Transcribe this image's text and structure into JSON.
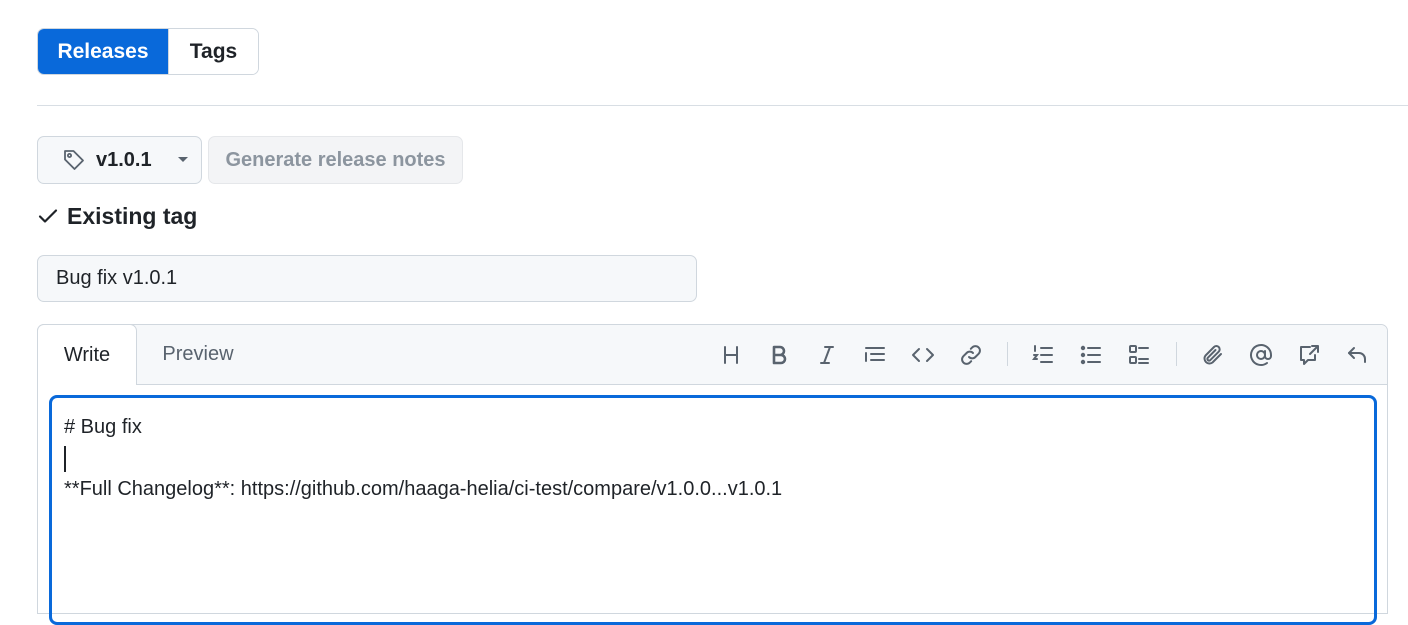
{
  "tabs": {
    "releases": "Releases",
    "tags": "Tags"
  },
  "tag_selector": {
    "value": "v1.0.1",
    "icon": "tag-icon"
  },
  "generate_notes_label": "Generate release notes",
  "tag_status": "Existing tag",
  "release_title": {
    "value": "Bug fix v1.0.1"
  },
  "editor": {
    "tab_write": "Write",
    "tab_preview": "Preview",
    "toolbar": [
      "heading",
      "bold",
      "italic",
      "quote",
      "code",
      "link",
      "ordered-list",
      "unordered-list",
      "task-list",
      "attach",
      "mention",
      "reference",
      "undo"
    ],
    "lines": [
      "# Bug fix",
      "",
      "**Full Changelog**: https://github.com/haaga-helia/ci-test/compare/v1.0.0...v1.0.1"
    ]
  },
  "colors": {
    "accent": "#0969da",
    "text": "#1f2328",
    "muted": "#59636e",
    "border": "#d0d7de",
    "disabled": "#8c959f"
  }
}
